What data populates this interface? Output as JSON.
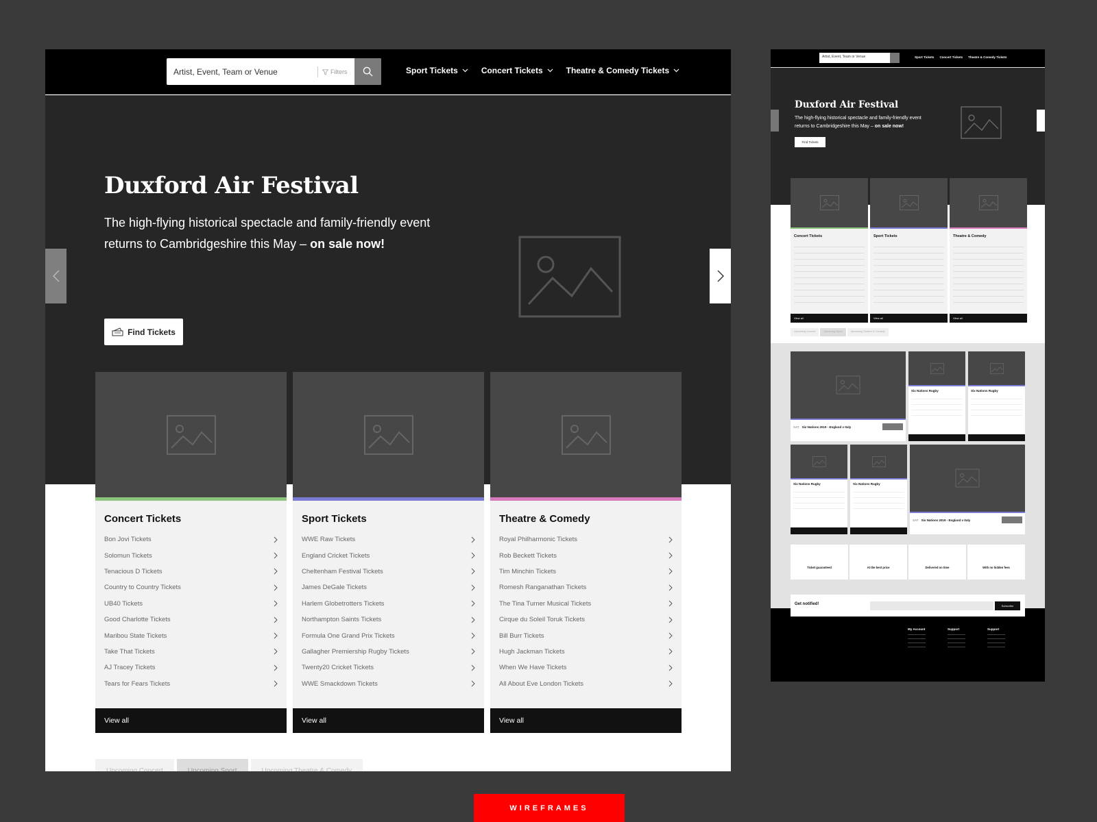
{
  "header": {
    "search_placeholder": "Artist, Event, Team or Venue",
    "filters_label": "Filters",
    "nav": [
      {
        "label": "Sport Tickets"
      },
      {
        "label": "Concert Tickets"
      },
      {
        "label": "Theatre & Comedy Tickets"
      }
    ]
  },
  "hero": {
    "title": "Duxford Air Festival",
    "text": "The high-flying historical spectacle and family-friendly event returns to Cambridgeshire this May – ",
    "text_bold": "on sale now!",
    "button": "Find Tickets"
  },
  "cards": [
    {
      "title": "Concert Tickets",
      "accent": "#8cc47c",
      "items": [
        "Bon Jovi Tickets",
        "Solomun Tickets",
        "Tenacious D Tickets",
        "Country to Country Tickets",
        "UB40 Tickets",
        "Good Charlotte Tickets",
        "Maribou State Tickets",
        "Take That Tickets",
        "AJ Tracey Tickets",
        "Tears for Fears Tickets"
      ],
      "view_all": "View all"
    },
    {
      "title": "Sport Tickets",
      "accent": "#7b7bd6",
      "items": [
        "WWE Raw Tickets",
        "England Cricket Tickets",
        "Cheltenham Festival Tickets",
        "James DeGale Tickets",
        "Harlem Globetrotters Tickets",
        "Northampton Saints Tickets",
        "Formula One Grand Prix Tickets",
        "Gallagher Premiership Rugby Tickets",
        "Twenty20 Cricket Tickets",
        "WWE Smackdown Tickets"
      ],
      "view_all": "View all"
    },
    {
      "title": "Theatre & Comedy",
      "accent": "#d97abf",
      "items": [
        "Royal Philharmonic Tickets",
        "Rob Beckett Tickets",
        "Tim Minchin Tickets",
        "Romesh Ranganathan Tickets",
        "The Tina Turner Musical Tickets",
        "Cirque du Soleil Toruk Tickets",
        "Bill Burr Tickets",
        "Hugh Jackman Tickets",
        "When We Have Tickets",
        "All About Eve London Tickets"
      ],
      "view_all": "View all"
    }
  ],
  "tabs": [
    "Upcoming Concert",
    "Upcoming Sport",
    "Upcoming Theatre & Comedy"
  ],
  "mini": {
    "search_placeholder": "Artist, Event, Team or Venue",
    "nav": [
      "Sport Tickets",
      "Concert Tickets",
      "Theatre & Comedy Tickets"
    ],
    "hero_title": "Duxford Air Festival",
    "hero_text": "The high-flying historical spectacle and family-friendly event returns to Cambridgeshire this May – ",
    "hero_text_bold": "on sale now!",
    "hero_button": "Find Tickets",
    "card_titles": [
      "Concert Tickets",
      "Sport Tickets",
      "Theatre & Comedy"
    ],
    "view_all": "View all",
    "tabs": [
      "Upcoming Concert",
      "Upcoming Sport",
      "Upcoming Theatre & Comedy"
    ],
    "tile_title": "Six Nations Rugby",
    "event_title": "Six Nations 2019 - England v Italy",
    "event_day": "SAT",
    "features": [
      "Ticket guaranteed",
      "At the best price",
      "Delivered on time",
      "With no hidden fees"
    ],
    "notify_title": "Get notified!",
    "subscribe": "Subscribe",
    "footer_cols": [
      "My Account",
      "Support",
      "Support"
    ]
  },
  "label": "WIREFRAMES"
}
